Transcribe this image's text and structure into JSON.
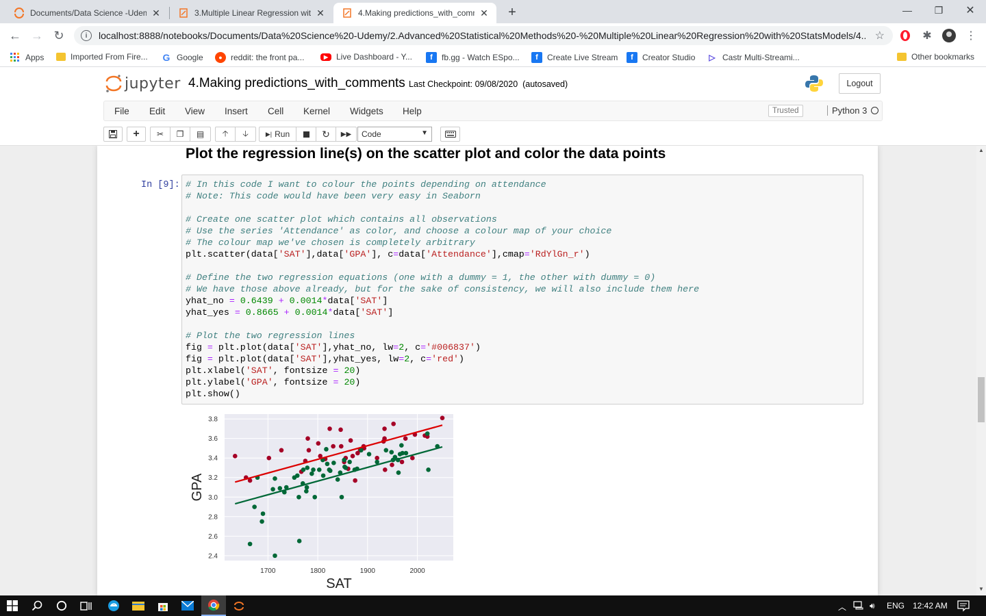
{
  "browser": {
    "tabs": [
      {
        "title": "Documents/Data Science -Udem",
        "icon": "jupyter-spinner-icon",
        "active": false
      },
      {
        "title": "3.Multiple Linear Regression with",
        "icon": "notebook-icon",
        "active": false
      },
      {
        "title": "4.Making predictions_with_comm",
        "icon": "notebook-icon",
        "active": true
      }
    ],
    "new_tab_symbol": "+",
    "url": "localhost:8888/notebooks/Documents/Data%20Science%20-Udemy/2.Advanced%20Statistical%20Methods%20-%20Multiple%20Linear%20Regression%20with%20StatsModels/4....",
    "bookmarks": [
      {
        "label": "Apps",
        "icon": "apps-grid-icon"
      },
      {
        "label": "Imported From Fire...",
        "icon": "folder-icon"
      },
      {
        "label": "Google",
        "icon": "google-icon"
      },
      {
        "label": "reddit: the front pa...",
        "icon": "reddit-icon"
      },
      {
        "label": "Live Dashboard - Y...",
        "icon": "youtube-icon"
      },
      {
        "label": "fb.gg - Watch ESpo...",
        "icon": "facebook-icon"
      },
      {
        "label": "Create Live Stream",
        "icon": "facebook-icon"
      },
      {
        "label": "Creator Studio",
        "icon": "facebook-icon"
      },
      {
        "label": "Castr Multi-Streami...",
        "icon": "castr-icon"
      }
    ],
    "other_bookmarks": "Other bookmarks"
  },
  "jupyter": {
    "logo_text": "jupyter",
    "notebook_title": "4.Making predictions_with_comments",
    "checkpoint": "Last Checkpoint: 09/08/2020",
    "autosave": "(autosaved)",
    "logout": "Logout",
    "menu": [
      "File",
      "Edit",
      "View",
      "Insert",
      "Cell",
      "Kernel",
      "Widgets",
      "Help"
    ],
    "trusted": "Trusted",
    "kernel": "Python 3",
    "run_label": "Run",
    "cell_type": "Code"
  },
  "notebook": {
    "heading": "Plot the regression line(s) on the scatter plot and color the data points",
    "prompt": "In [9]:"
  },
  "chart_data": {
    "type": "scatter",
    "xlabel": "SAT",
    "ylabel": "GPA",
    "xlim": [
      1613,
      2072
    ],
    "ylim": [
      2.35,
      3.85
    ],
    "xticks": [
      1700,
      1800,
      1900,
      2000
    ],
    "yticks": [
      2.4,
      2.6,
      2.8,
      3.0,
      3.2,
      3.4,
      3.6,
      3.8
    ],
    "grid": true,
    "background": "#eaeaf2",
    "lines": [
      {
        "intercept": 0.6439,
        "slope": 0.0014,
        "color": "#006837",
        "x_range": [
          1634,
          2050
        ]
      },
      {
        "intercept": 0.8665,
        "slope": 0.0014,
        "color": "#dc0000",
        "x_range": [
          1634,
          2050
        ]
      }
    ],
    "series": [
      {
        "color": "#a50026",
        "points": [
          [
            1634,
            3.42
          ],
          [
            1656,
            3.2
          ],
          [
            1664,
            3.17
          ],
          [
            1702,
            3.4
          ],
          [
            1727,
            3.48
          ],
          [
            1767,
            3.26
          ],
          [
            1775,
            3.37
          ],
          [
            1780,
            3.6
          ],
          [
            1782,
            3.48
          ],
          [
            1801,
            3.55
          ],
          [
            1805,
            3.42
          ],
          [
            1815,
            3.39
          ],
          [
            1824,
            3.7
          ],
          [
            1831,
            3.52
          ],
          [
            1846,
            3.69
          ],
          [
            1847,
            3.52
          ],
          [
            1853,
            3.36
          ],
          [
            1856,
            3.4
          ],
          [
            1861,
            3.29
          ],
          [
            1866,
            3.58
          ],
          [
            1870,
            3.42
          ],
          [
            1875,
            3.17
          ],
          [
            1880,
            3.45
          ],
          [
            1885,
            3.48
          ],
          [
            1892,
            3.52
          ],
          [
            1893,
            3.5
          ],
          [
            1919,
            3.4
          ],
          [
            1932,
            3.57
          ],
          [
            1934,
            3.7
          ],
          [
            1934,
            3.6
          ],
          [
            1935,
            3.28
          ],
          [
            1949,
            3.33
          ],
          [
            1952,
            3.75
          ],
          [
            1969,
            3.36
          ],
          [
            1976,
            3.6
          ],
          [
            1990,
            3.4
          ],
          [
            1995,
            3.64
          ],
          [
            2015,
            3.63
          ],
          [
            2020,
            3.62
          ],
          [
            2050,
            3.81
          ]
        ]
      },
      {
        "color": "#006837",
        "points": [
          [
            1664,
            2.52
          ],
          [
            1673,
            2.9
          ],
          [
            1679,
            3.2
          ],
          [
            1688,
            2.75
          ],
          [
            1690,
            2.83
          ],
          [
            1710,
            3.08
          ],
          [
            1714,
            3.19
          ],
          [
            1714,
            2.4
          ],
          [
            1724,
            3.09
          ],
          [
            1733,
            3.05
          ],
          [
            1737,
            3.1
          ],
          [
            1753,
            3.2
          ],
          [
            1759,
            3.22
          ],
          [
            1762,
            3.0
          ],
          [
            1763,
            2.55
          ],
          [
            1770,
            3.14
          ],
          [
            1771,
            3.28
          ],
          [
            1777,
            3.06
          ],
          [
            1778,
            3.1
          ],
          [
            1779,
            3.3
          ],
          [
            1788,
            3.24
          ],
          [
            1791,
            3.28
          ],
          [
            1794,
            3.0
          ],
          [
            1803,
            3.28
          ],
          [
            1810,
            3.38
          ],
          [
            1811,
            3.22
          ],
          [
            1817,
            3.49
          ],
          [
            1819,
            3.34
          ],
          [
            1823,
            3.28
          ],
          [
            1825,
            3.27
          ],
          [
            1832,
            3.35
          ],
          [
            1840,
            3.18
          ],
          [
            1845,
            3.25
          ],
          [
            1848,
            3.0
          ],
          [
            1853,
            3.38
          ],
          [
            1854,
            3.31
          ],
          [
            1856,
            3.3
          ],
          [
            1864,
            3.36
          ],
          [
            1874,
            3.28
          ],
          [
            1879,
            3.29
          ],
          [
            1887,
            3.48
          ],
          [
            1903,
            3.44
          ],
          [
            1919,
            3.36
          ],
          [
            1937,
            3.48
          ],
          [
            1948,
            3.46
          ],
          [
            1951,
            3.38
          ],
          [
            1955,
            3.41
          ],
          [
            1961,
            3.38
          ],
          [
            1962,
            3.25
          ],
          [
            1965,
            3.44
          ],
          [
            1968,
            3.53
          ],
          [
            1970,
            3.45
          ],
          [
            1977,
            3.45
          ],
          [
            2020,
            3.65
          ],
          [
            2022,
            3.28
          ],
          [
            2040,
            3.52
          ]
        ]
      }
    ]
  }
}
